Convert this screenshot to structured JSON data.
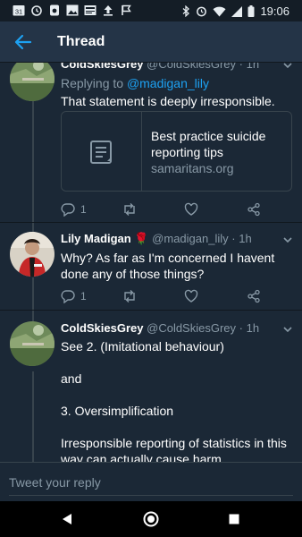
{
  "status_bar": {
    "time": "19:06",
    "calendar_day": "31",
    "left_icons": [
      "calendar-icon",
      "alarm-icon",
      "app-icon",
      "image-icon",
      "news-icon",
      "upload-icon",
      "flag-icon"
    ],
    "right_icons": [
      "bluetooth-icon",
      "alarm-icon",
      "wifi-icon",
      "signal-icon",
      "battery-icon"
    ]
  },
  "appbar": {
    "title": "Thread",
    "back_icon": "back-arrow-icon"
  },
  "tweets": [
    {
      "name": "ColdSkiesGrey",
      "handle": "@ColdSkiesGrey",
      "time": "1h",
      "replying_label": "Replying to",
      "replying_handle": "@madigan_lily",
      "text": "That statement is deeply irresponsible.",
      "card": {
        "title": "Best practice suicide reporting tips",
        "domain": "samaritans.org",
        "icon": "article-icon"
      },
      "reply_count": "1"
    },
    {
      "name": "Lily Madigan",
      "name_emoji": "🌹",
      "handle": "@madigan_lily",
      "time": "1h",
      "text": "Why? As far as I'm concerned I havent done any of those things?",
      "reply_count": "1"
    },
    {
      "name": "ColdSkiesGrey",
      "handle": "@ColdSkiesGrey",
      "time": "1h",
      "text_lines": [
        "See 2. (Imitational behaviour)",
        "",
        "and",
        "",
        "3. Oversimplification",
        "",
        "Irresponsible reporting of statistics in this way can actually cause harm."
      ]
    }
  ],
  "reply_bar": {
    "placeholder": "Tweet your reply"
  },
  "nav": {
    "back_icon": "nav-back-icon",
    "home_icon": "nav-home-icon",
    "recents_icon": "nav-recents-icon"
  },
  "colors": {
    "background": "#1b2836",
    "appbar": "#243447",
    "accent": "#1da1f2",
    "muted": "#8899a6"
  }
}
